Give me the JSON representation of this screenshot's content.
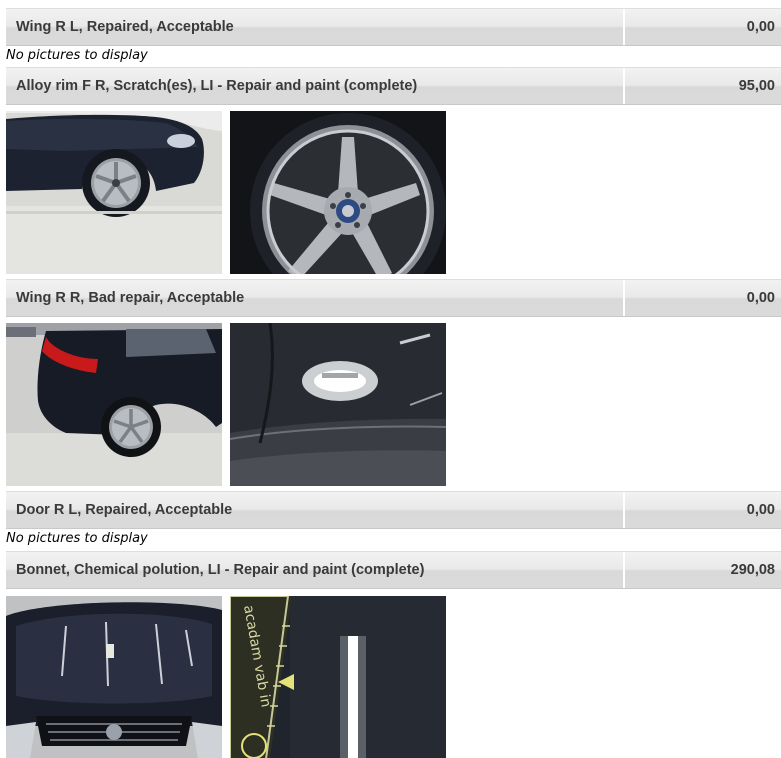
{
  "no_pictures_text": "No pictures to display",
  "items": [
    {
      "description": "Wing R L, Repaired, Acceptable",
      "price": "0,00"
    },
    {
      "description": "Alloy rim F R, Scratch(es), LI - Repair and paint (complete)",
      "price": "95,00"
    },
    {
      "description": "Wing R R, Bad repair, Acceptable",
      "price": "0,00"
    },
    {
      "description": "Door R L, Repaired, Acceptable",
      "price": "0,00"
    },
    {
      "description": "Bonnet, Chemical polution, LI - Repair and paint (complete)",
      "price": "290,08"
    }
  ],
  "photo_overlay_text": "acadam vab in"
}
